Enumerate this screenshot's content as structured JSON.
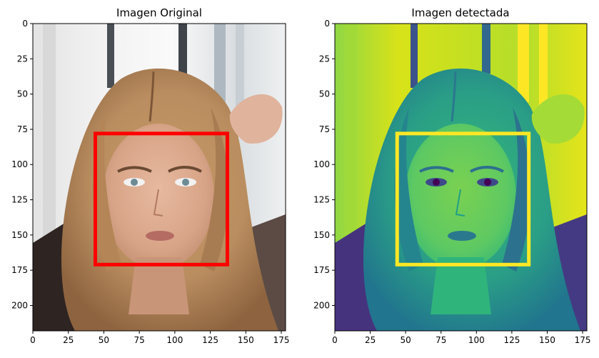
{
  "figure": {
    "panels": [
      {
        "title": "Imagen Original",
        "image": "color photo of a woman with long blonde hair, one hand raised to her head",
        "box_color": "#ff0000",
        "x_ticks": [
          "0",
          "25",
          "50",
          "75",
          "100",
          "125",
          "150",
          "175"
        ],
        "y_ticks": [
          "0",
          "25",
          "50",
          "75",
          "100",
          "125",
          "150",
          "175",
          "200"
        ]
      },
      {
        "title": "Imagen detectada",
        "image": "same photo rendered as single-channel grayscale with viridis colormap",
        "box_color": "#fde725",
        "x_ticks": [
          "0",
          "25",
          "50",
          "75",
          "100",
          "125",
          "150",
          "175"
        ],
        "y_ticks": [
          "0",
          "25",
          "50",
          "75",
          "100",
          "125",
          "150",
          "175",
          "200"
        ]
      }
    ],
    "detection_box": {
      "x0": 44,
      "y0": 78,
      "x1": 137,
      "y1": 171
    },
    "image_extent": {
      "width": 178,
      "height": 218
    }
  }
}
